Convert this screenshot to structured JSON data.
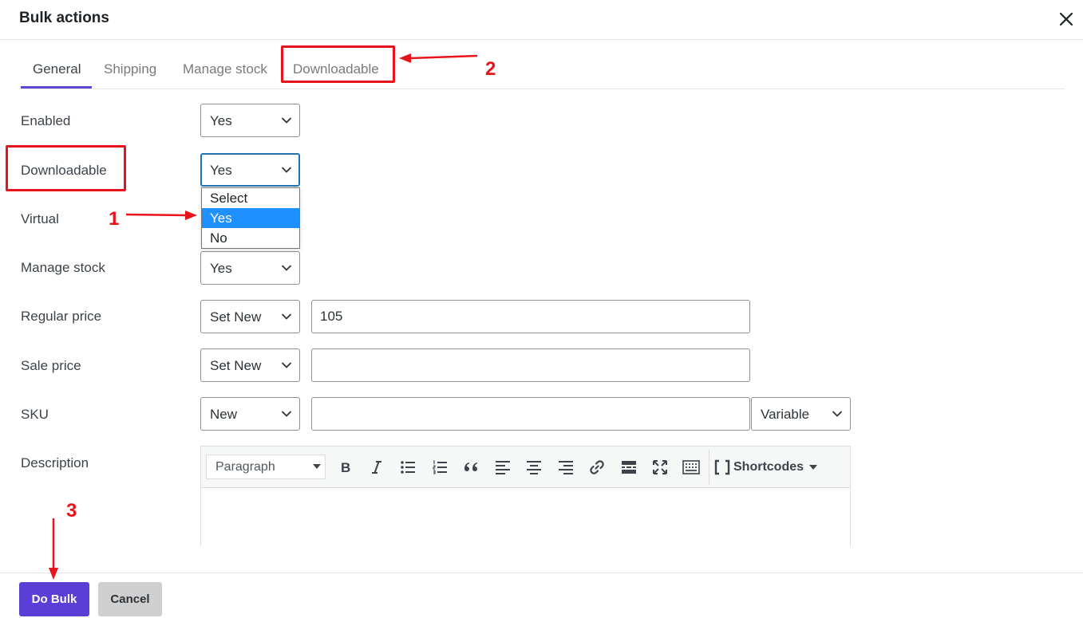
{
  "modal": {
    "title": "Bulk actions",
    "close_icon": "close-icon"
  },
  "tabs": [
    {
      "label": "General",
      "active": true
    },
    {
      "label": "Shipping",
      "active": false
    },
    {
      "label": "Manage stock",
      "active": false
    },
    {
      "label": "Downloadable",
      "active": false
    }
  ],
  "fields": {
    "enabled": {
      "label": "Enabled",
      "value": "Yes"
    },
    "downloadable": {
      "label": "Downloadable",
      "value": "Yes",
      "options": [
        {
          "label": "Select",
          "selected": false
        },
        {
          "label": "Yes",
          "selected": true
        },
        {
          "label": "No",
          "selected": false
        }
      ]
    },
    "virtual": {
      "label": "Virtual"
    },
    "manage_stock": {
      "label": "Manage stock",
      "value": "Yes"
    },
    "regular_price": {
      "label": "Regular price",
      "mode": "Set New",
      "value": "105"
    },
    "sale_price": {
      "label": "Sale price",
      "mode": "Set New",
      "value": ""
    },
    "sku": {
      "label": "SKU",
      "mode": "New",
      "value": "",
      "type": "Variable"
    },
    "description": {
      "label": "Description",
      "format": "Paragraph",
      "toolbar_icons": [
        "bold-icon",
        "italic-icon",
        "bullet-list-icon",
        "numbered-list-icon",
        "blockquote-icon",
        "align-left-icon",
        "align-center-icon",
        "align-right-icon",
        "link-icon",
        "read-more-icon",
        "fullscreen-icon",
        "toolbar-toggle-icon"
      ],
      "shortcodes_label": "Shortcodes"
    }
  },
  "footer": {
    "do_bulk_label": "Do Bulk",
    "cancel_label": "Cancel"
  },
  "annotations": {
    "step_1": "1",
    "step_2": "2",
    "step_3": "3",
    "color": "#e8141c"
  },
  "colors": {
    "accent": "#5b3ed6",
    "tab_underline": "#5b49d6",
    "option_highlight": "#1e90ff"
  }
}
